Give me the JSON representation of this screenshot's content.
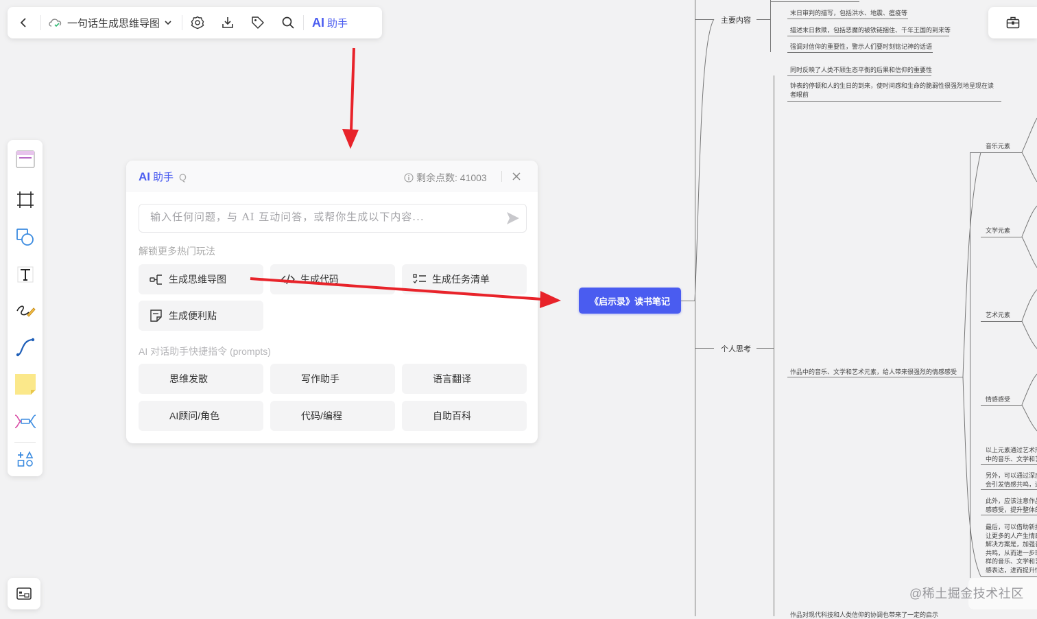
{
  "toolbar": {
    "doc_title": "一句话生成思维导图",
    "ai_label": "AI",
    "ai_sub": "助手"
  },
  "ai_panel": {
    "title_ai": "AI",
    "title_sub": "助手",
    "title_q": "Q",
    "points_label": "剩余点数: 41003",
    "input_placeholder": "输入任何问题，与 AI 互动问答，或帮你生成以下内容...",
    "section_unlock": "解锁更多热门玩法",
    "actions": [
      "生成思维导图",
      "生成代码",
      "生成任务清单",
      "生成便利贴"
    ],
    "section_prompts": "AI 对话助手快捷指令 (prompts)",
    "prompts": [
      "思维发散",
      "写作助手",
      "语言翻译",
      "AI顾问/角色",
      "代码/编程",
      "自助百科"
    ]
  },
  "mindmap": {
    "root": "《启示录》读书笔记",
    "branch_main": "主要内容",
    "branch_thoughts": "个人思考",
    "main_leaves": [
      "末日审判的描写，包括洪水、地震、瘟疫等",
      "描述末日救赎，包括恶魔的被铁链捆住、千年王国的到来等",
      "强调对信仰的重要性，警示人们要时刻铭记神的话语",
      "同时反映了人类不顾生态平衡的后果和信仰的重要性",
      "钟表的停顿和人的生日的到来，使时间感和生命的脆弱性很强烈地呈现在读者眼前"
    ],
    "thought_leaf": "作品中的音乐、文学和艺术元素，给人带来很强烈的情感感受",
    "sub_nodes": [
      "音乐元素",
      "文学元素",
      "艺术元素",
      "情感感受"
    ],
    "partial_leaves": [
      "以上元素通过艺术形\n中的音乐、文学和艺",
      "另外，可以通过深度\n会引发情感共鸣，进",
      "此外，应该注意作品\n感感受，提升整体的",
      "最后，可以借助新技\n让更多的人产生情感\n解决方案是，加强音\n共鸣，从而进一步理\n样的音乐、文学和艺\n感表达，进而提升情"
    ],
    "bottom_leaf": "作品对现代科技和人类信仰的协调也带来了一定的启示"
  },
  "watermark": "@稀土掘金技术社区"
}
